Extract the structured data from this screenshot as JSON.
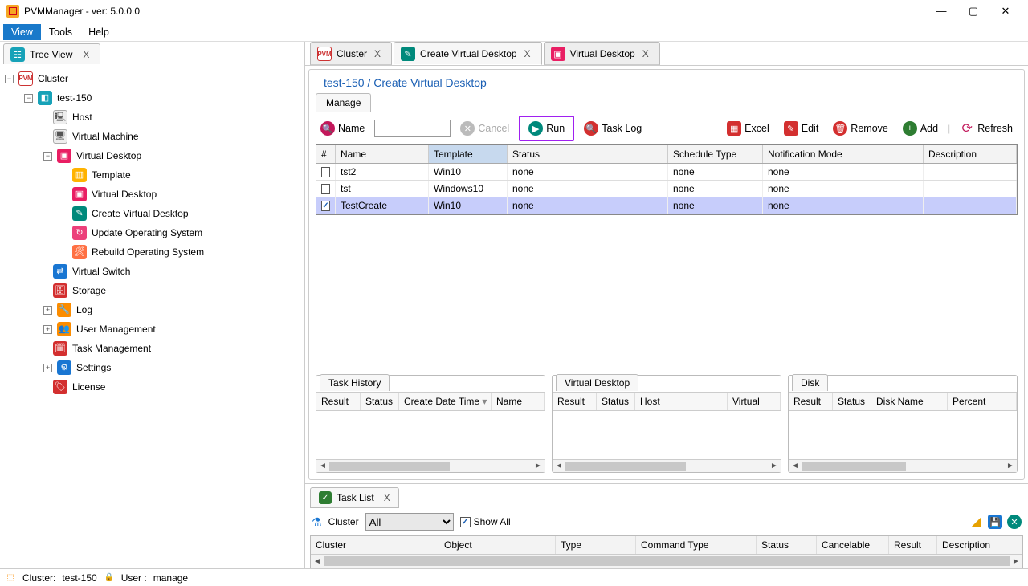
{
  "window": {
    "title": "PVMManager - ver: 5.0.0.0"
  },
  "menubar": {
    "view": "View",
    "tools": "Tools",
    "help": "Help"
  },
  "left_tab": {
    "label": "Tree View",
    "close": "X"
  },
  "tree": {
    "root": "Cluster",
    "node": "test-150",
    "items": {
      "host": "Host",
      "vm": "Virtual Machine",
      "vd": "Virtual Desktop",
      "tpl": "Template",
      "vdsk": "Virtual Desktop",
      "cvd": "Create Virtual Desktop",
      "upd": "Update Operating System",
      "reb": "Rebuild Operating System",
      "sw": "Virtual Switch",
      "stor": "Storage",
      "log": "Log",
      "usr": "User Management",
      "task": "Task Management",
      "set": "Settings",
      "lic": "License"
    }
  },
  "rtabs": {
    "cluster": "Cluster",
    "cvd": "Create Virtual Desktop",
    "vd": "Virtual Desktop",
    "close": "X"
  },
  "breadcrumb": "test-150 / Create Virtual Desktop",
  "subtab": "Manage",
  "toolbar": {
    "name_label": "Name",
    "name_value": "",
    "cancel": "Cancel",
    "run": "Run",
    "tasklog": "Task Log",
    "excel": "Excel",
    "edit": "Edit",
    "remove": "Remove",
    "add": "Add",
    "refresh": "Refresh"
  },
  "grid": {
    "cols": {
      "num": "#",
      "name": "Name",
      "template": "Template",
      "status": "Status",
      "sched": "Schedule Type",
      "notif": "Notification Mode",
      "desc": "Description"
    },
    "rows": [
      {
        "checked": false,
        "name": "tst2",
        "template": "Win10",
        "status": "none",
        "sched": "none",
        "notif": "none",
        "desc": ""
      },
      {
        "checked": false,
        "name": "tst",
        "template": "Windows10",
        "status": "none",
        "sched": "none",
        "notif": "none",
        "desc": ""
      },
      {
        "checked": true,
        "name": "TestCreate",
        "template": "Win10",
        "status": "none",
        "sched": "none",
        "notif": "none",
        "desc": ""
      }
    ]
  },
  "panels": {
    "history": {
      "title": "Task History",
      "cols": {
        "result": "Result",
        "status": "Status",
        "cdt": "Create Date Time",
        "name": "Name"
      }
    },
    "vd": {
      "title": "Virtual Desktop",
      "cols": {
        "result": "Result",
        "status": "Status",
        "host": "Host",
        "vd": "Virtual"
      }
    },
    "disk": {
      "title": "Disk",
      "cols": {
        "result": "Result",
        "status": "Status",
        "dname": "Disk Name",
        "pct": "Percent"
      }
    }
  },
  "tasklist": {
    "tab": "Task List",
    "close": "X",
    "filter_label": "Cluster",
    "filter_value": "All",
    "showall": "Show All",
    "cols": {
      "cluster": "Cluster",
      "object": "Object",
      "type": "Type",
      "cmd": "Command Type",
      "status": "Status",
      "cancel": "Cancelable",
      "result": "Result",
      "desc": "Description"
    }
  },
  "status": {
    "cluster_label": "Cluster:",
    "cluster": "test-150",
    "user_label": "User :",
    "user": "manage"
  }
}
